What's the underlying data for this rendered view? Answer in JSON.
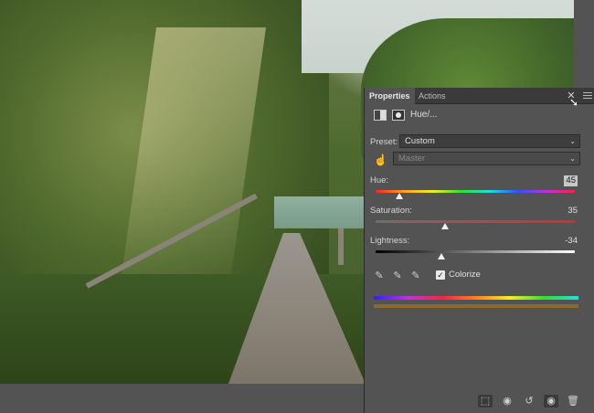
{
  "panel": {
    "tabs": [
      {
        "label": "Properties",
        "active": true
      },
      {
        "label": "Actions",
        "active": false
      }
    ],
    "adjustment_title": "Hue/...",
    "preset_label": "Preset:",
    "preset_value": "Custom",
    "channel_value": "Master",
    "hue": {
      "label": "Hue:",
      "value": "45",
      "position": 0.12
    },
    "saturation": {
      "label": "Saturation:",
      "value": "35",
      "position": 0.35
    },
    "lightness": {
      "label": "Lightness:",
      "value": "-34",
      "position": 0.33
    },
    "colorize": {
      "label": "Colorize",
      "checked": true
    }
  },
  "icons": {
    "close": "close-icon",
    "menu": "panel-menu-icon",
    "hand": "targeted-adjustment-hand-icon",
    "eyedroppers": [
      "eyedropper-icon",
      "eyedropper-plus-icon",
      "eyedropper-minus-icon"
    ],
    "toolbar": [
      "clip-to-layer-icon",
      "view-previous-state-icon",
      "reset-icon",
      "visibility-eye-icon",
      "trash-icon"
    ]
  },
  "colors": {
    "panel_bg": "#535353",
    "tab_bar_bg": "#3a3a3a",
    "result_bar": "#8a6a30"
  }
}
